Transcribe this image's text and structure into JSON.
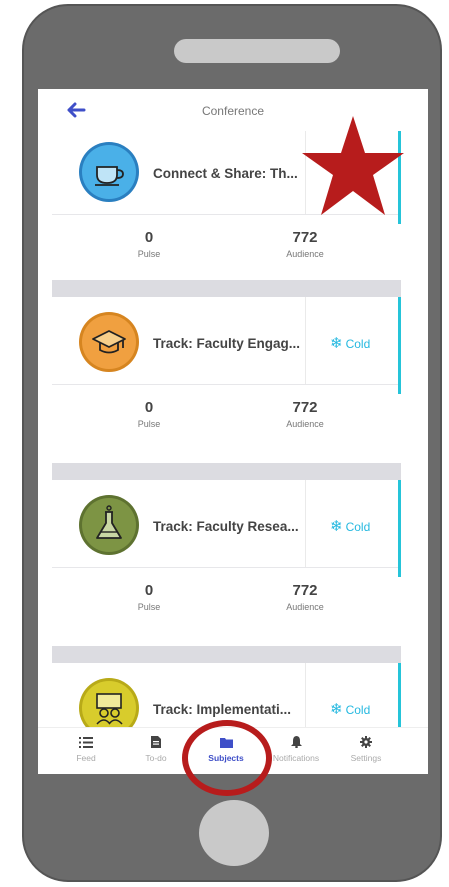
{
  "header": {
    "title": "Conference"
  },
  "subjects": [
    {
      "title": "Connect & Share: Th...",
      "temperature": "",
      "pulse": "0",
      "audience": "772",
      "pulse_label": "Pulse",
      "audience_label": "Audience",
      "icon": "coffee-cup-icon",
      "icon_color": "#4ab0e8"
    },
    {
      "title": "Track: Faculty Engag...",
      "temperature": "Cold",
      "pulse": "0",
      "audience": "772",
      "pulse_label": "Pulse",
      "audience_label": "Audience",
      "icon": "graduation-cap-icon",
      "icon_color": "#f0a040"
    },
    {
      "title": "Track: Faculty Resea...",
      "temperature": "Cold",
      "pulse": "0",
      "audience": "772",
      "pulse_label": "Pulse",
      "audience_label": "Audience",
      "icon": "flask-icon",
      "icon_color": "#7d9444"
    },
    {
      "title": "Track: Implementati...",
      "temperature": "Cold",
      "icon": "people-icon",
      "icon_color": "#d8cc2c"
    }
  ],
  "tabs": [
    {
      "label": "Feed",
      "icon": "list-icon"
    },
    {
      "label": "To-do",
      "icon": "document-icon"
    },
    {
      "label": "Subjects",
      "icon": "folder-icon"
    },
    {
      "label": "Notifications",
      "icon": "bell-icon"
    },
    {
      "label": "Settings",
      "icon": "gear-icon"
    }
  ],
  "colors": {
    "accent": "#25c4d9",
    "active_tab": "#3f4fc8",
    "cold": "#26b9e0",
    "annotation_red": "#b71c1c"
  }
}
